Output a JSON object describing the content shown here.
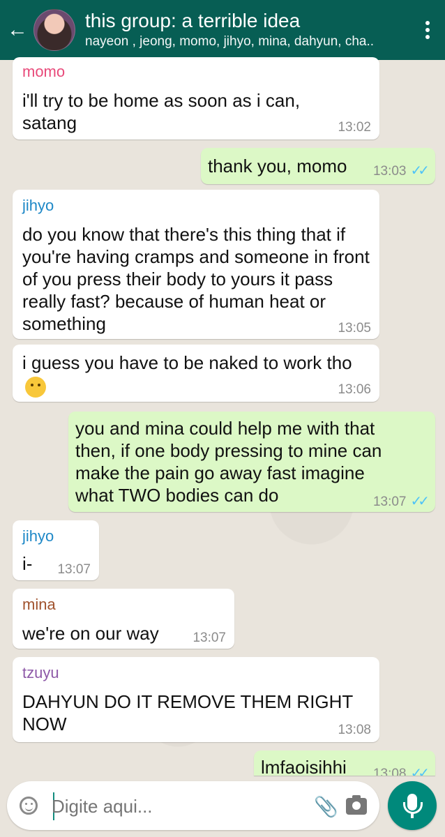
{
  "header": {
    "title": "this group: a terrible idea",
    "subtitle": "nayeon , jeong, momo, jihyo, mina, dahyun, cha.."
  },
  "messages": [
    {
      "sender": "momo",
      "text": "i'll try to be home as soon as i can, satang",
      "time": "13:02"
    },
    {
      "text": "thank you, momo",
      "time": "13:03",
      "ticks": "✓✓"
    },
    {
      "sender": "jihyo",
      "text": "do you know that there's this thing that if you're having cramps and someone in front of you press their body to yours it pass really fast? because of human heat or something",
      "time": "13:05"
    },
    {
      "text": "i guess you have to be naked to work tho",
      "time": "13:06"
    },
    {
      "text": "you and mina could help me with that then, if one body pressing to mine can make the pain go away fast imagine what TWO bodies can do",
      "time": "13:07",
      "ticks": "✓✓"
    },
    {
      "sender": "jihyo",
      "text": "i-",
      "time": "13:07"
    },
    {
      "sender": "mina",
      "text": "we're on our way",
      "time": "13:07"
    },
    {
      "sender": "tzuyu",
      "text": "DAHYUN DO IT REMOVE THEM RIGHT NOW",
      "time": "13:08"
    },
    {
      "text": "lmfaoisihhi",
      "time": "13:08",
      "ticks": "✓✓"
    }
  ],
  "input": {
    "placeholder": "Digite aqui..."
  },
  "colors": {
    "header": "#075E54",
    "outgoing": "#DCF8C6",
    "incoming": "#FFFFFF",
    "momo": "#E84A7A",
    "jihyo": "#1E88C7",
    "mina": "#A0522D",
    "tzuyu": "#8E5AA8",
    "ticks": "#4FC3F7",
    "mic": "#00897B"
  }
}
